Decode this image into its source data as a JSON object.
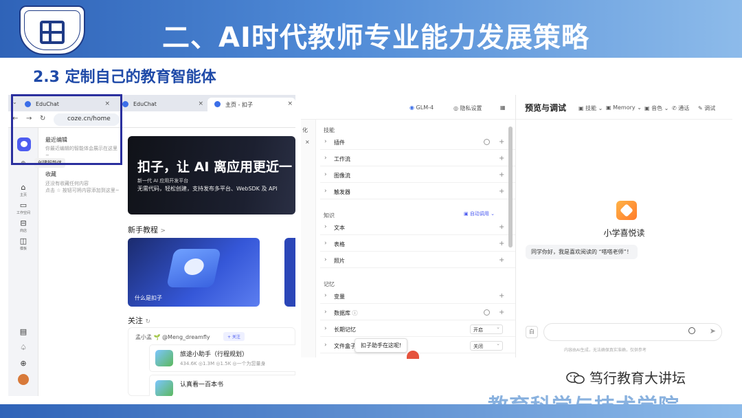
{
  "slide": {
    "title": "二、AI时代教师专业能力发展策略",
    "subtitle": "2.3 定制自己的教育智能体",
    "watermark": "笃行教育大讲坛",
    "college": "教育科学与技术学院",
    "colors": {
      "band": "#2f63b8",
      "subtitle": "#1f4aa8",
      "highlight": "#2a2f9e"
    }
  },
  "browser": {
    "tabs": [
      {
        "label": "EduChat",
        "close": "×"
      },
      {
        "label": "EduChat",
        "close": "×"
      },
      {
        "label": "主页 - 扣子",
        "close": "×"
      }
    ],
    "url": "coze.cn/home"
  },
  "coze": {
    "sidebar": [
      {
        "icon": "home-icon",
        "label": "主页"
      },
      {
        "icon": "folder-icon",
        "label": "工作空间"
      },
      {
        "icon": "store-icon",
        "label": "商店"
      },
      {
        "icon": "template-icon",
        "label": "模板"
      }
    ],
    "panel": {
      "recent_title": "最近编辑",
      "recent_desc": "你最近编辑的智能体会展示在这里~",
      "tooltip": "创建智能体",
      "fav_title": "收藏",
      "fav_desc1": "还没有收藏任何内容",
      "fav_desc2": "点击 ☆ 按钮可将内容添加到这里~"
    },
    "banner": {
      "headline": "扣子，让 AI 离应用更近一",
      "line1": "新一代 AI 应用开发平台",
      "line2": "无需代码，轻松创建，支持发布多平台、WebSDK 及 API"
    },
    "tutorial_title": "新手教程",
    "tutorial_chevron": ">",
    "card_label": "什么是扣子",
    "follow_title": "关注",
    "feed": {
      "user": "孟小孟 🌱 @Meng_dreamfly",
      "follow_btn": "+ 关注",
      "bot1_name": "旅途小助手（行程规划）",
      "bot1_meta": "434.6K  ◎1.3M  ◎1.5K  ◎一个为您量身",
      "bot2_name": "认真看一百本书"
    }
  },
  "config": {
    "leftstrip": [
      "化",
      "×"
    ],
    "header": {
      "model": "GLM-4",
      "privacy": "隐私设置",
      "preview_title": "预览与调试",
      "skill": "技能",
      "memory": "Memory",
      "voice": "音色",
      "call": "通话",
      "debug": "调试"
    },
    "groups": {
      "skill": "技能",
      "knowledge": "知识",
      "memory": "记忆"
    },
    "auto_call": "自动调用",
    "rows": {
      "plugin": "插件",
      "workflow": "工作流",
      "imageflow": "图像流",
      "trigger": "触发器",
      "text": "文本",
      "table": "表格",
      "photo": "照片",
      "variable": "变量",
      "database": "数据库",
      "ltm": "长期记忆",
      "filebox": "文件盒子"
    },
    "ltm_value": "开启",
    "filebox_value": "关闭",
    "plus": "+"
  },
  "preview": {
    "agent_name": "小学喜悦读",
    "greeting": "同学你好，我是喜欢阅读的 “嗒嗒老师”！",
    "disclaimer": "内容由AI生成，无法确保真实准确，仅供参考",
    "helper": "扣子助手在这呢!",
    "send": "➤",
    "clear": "白"
  }
}
